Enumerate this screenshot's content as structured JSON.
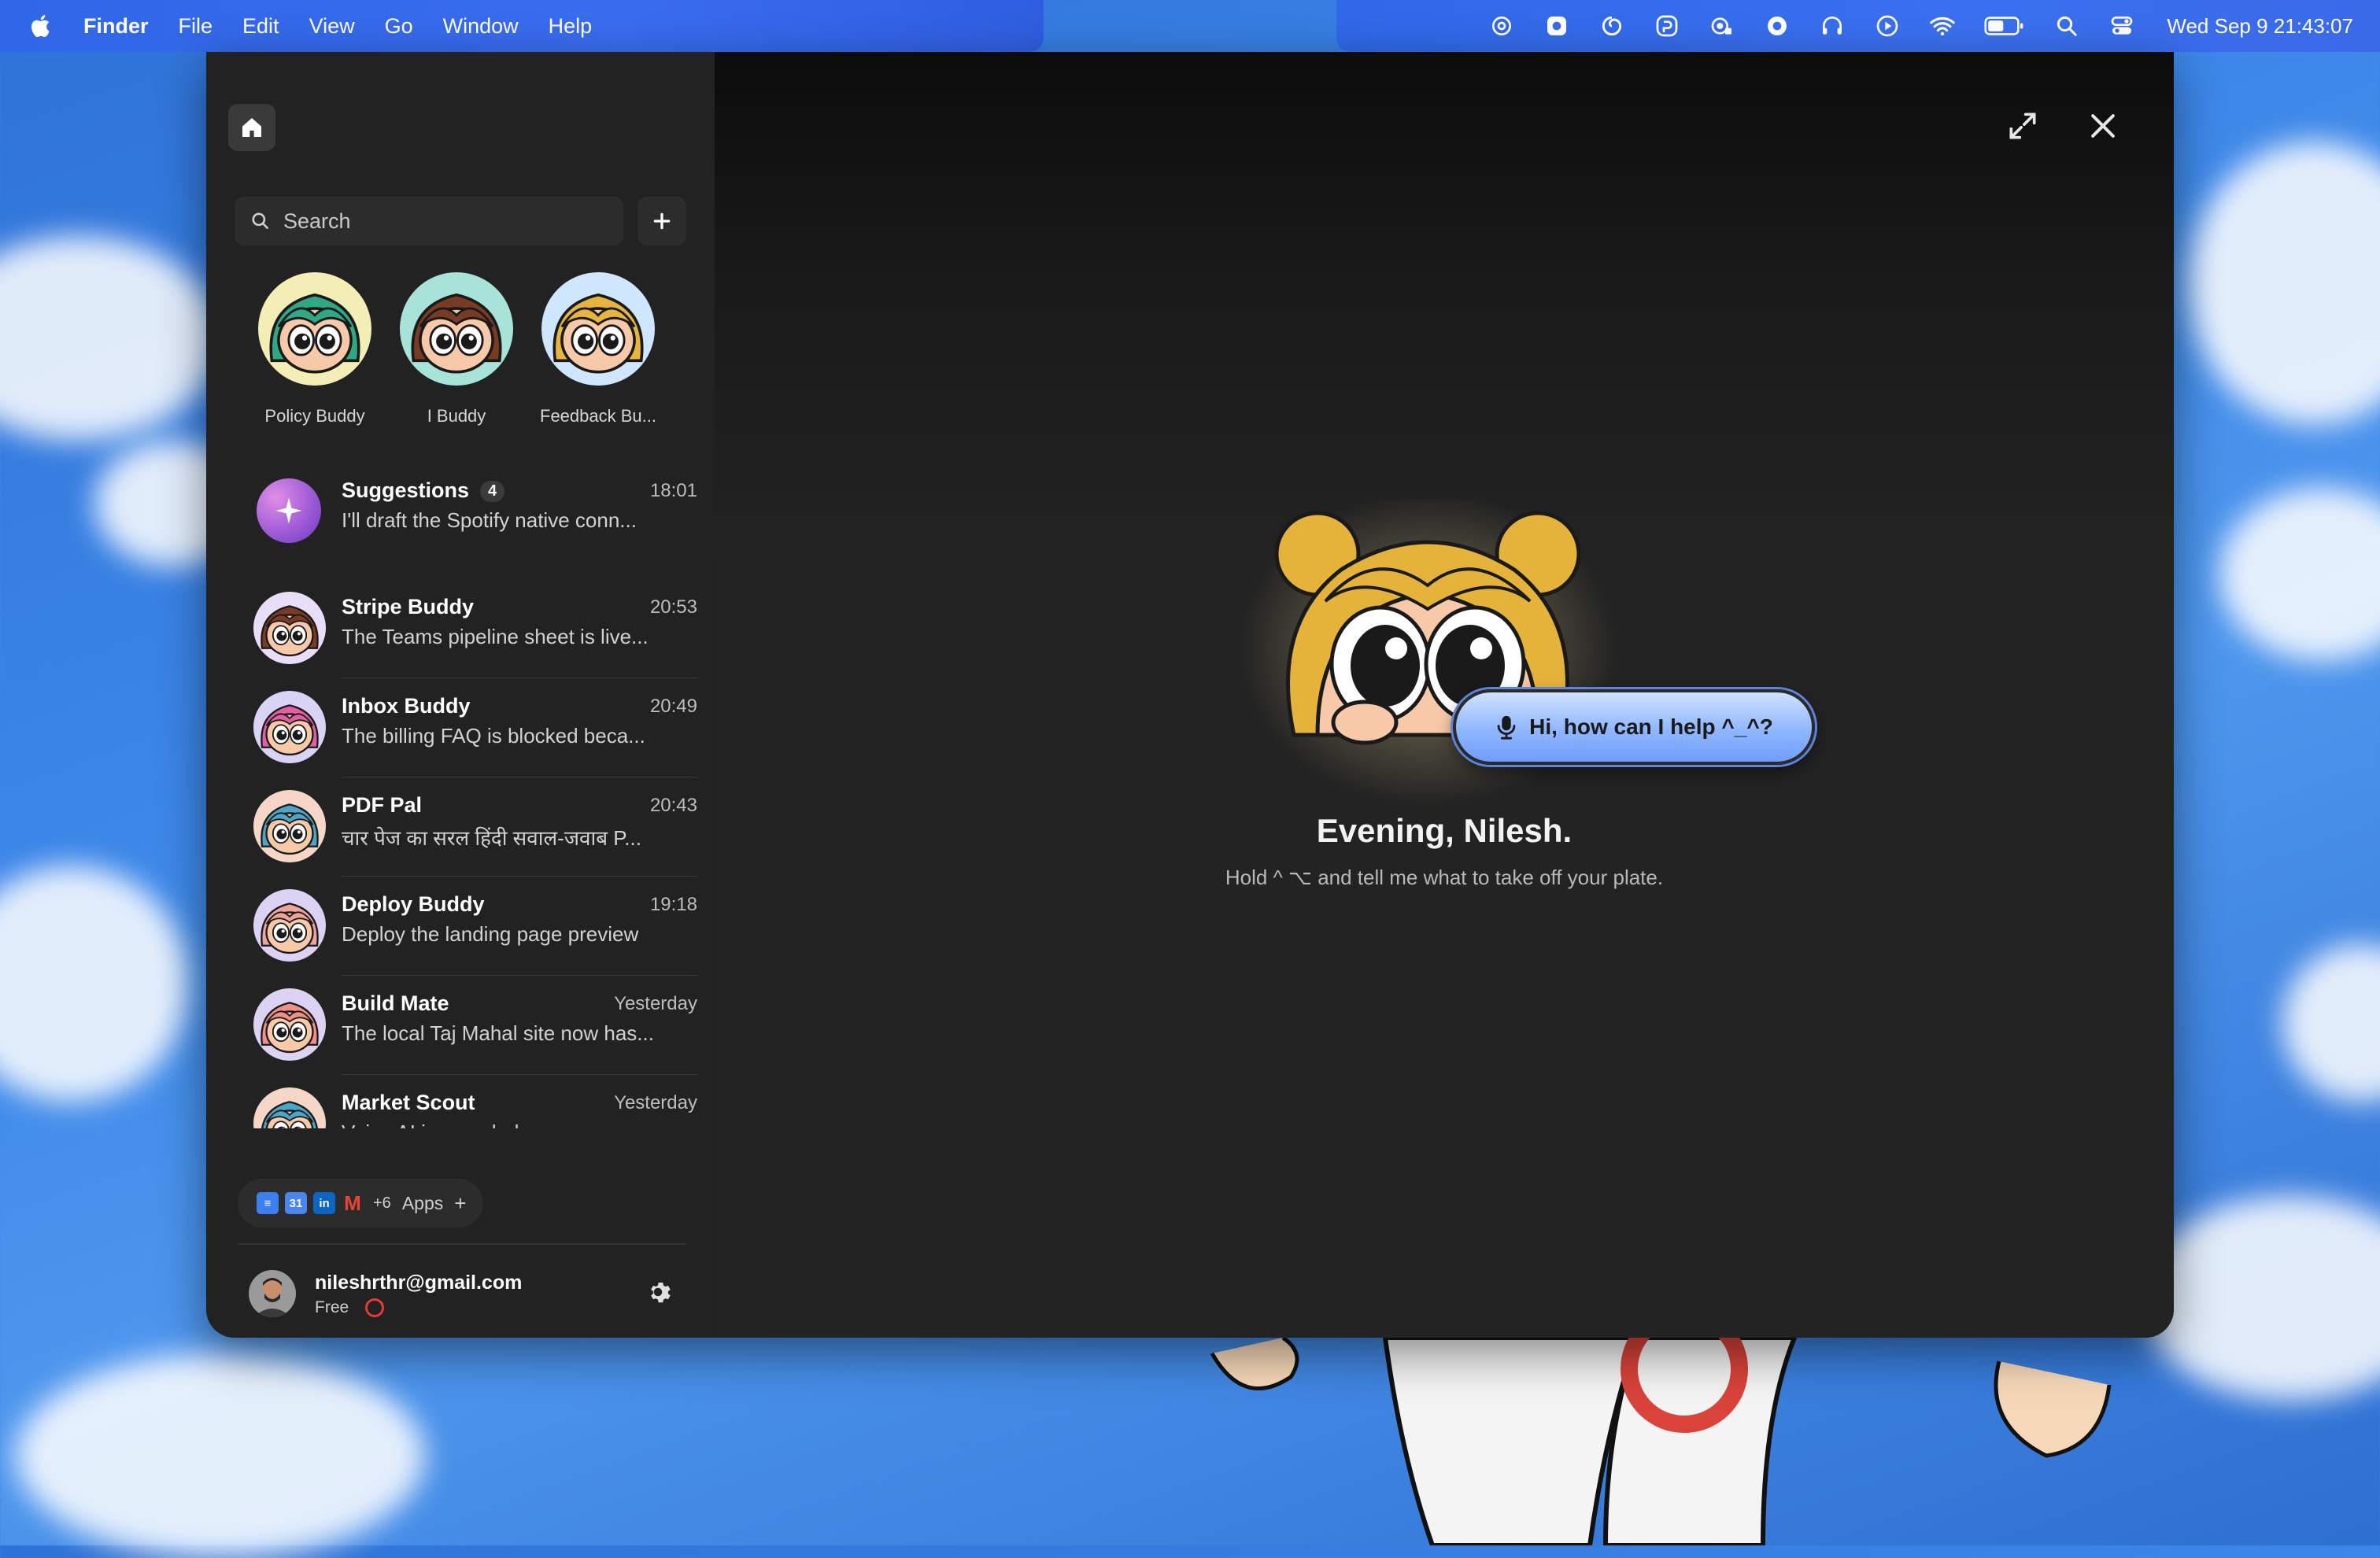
{
  "menubar": {
    "app": "Finder",
    "items": [
      "File",
      "Edit",
      "View",
      "Go",
      "Window",
      "Help"
    ],
    "clock": "Wed Sep 9  21:43:07"
  },
  "sidebar": {
    "search_placeholder": "Search",
    "pinned": [
      {
        "label": "Policy Buddy",
        "bg": "#f2eeb5",
        "hair": "#2fa884"
      },
      {
        "label": "I Buddy",
        "bg": "#a7e3d8",
        "hair": "#7a3b24"
      },
      {
        "label": "Feedback Bu...",
        "bg": "#cfe6ff",
        "hair": "#e8b53c"
      }
    ],
    "conversations": [
      {
        "name": "Suggestions",
        "badge": "4",
        "time": "18:01",
        "preview": "I'll draft the Spotify native conn...",
        "type": "suggestions"
      },
      {
        "name": "Stripe Buddy",
        "time": "20:53",
        "preview": "The Teams pipeline sheet is live...",
        "bg": "#e9def8",
        "hair": "#7a3b24"
      },
      {
        "name": "Inbox Buddy",
        "time": "20:49",
        "preview": "The billing FAQ is blocked beca...",
        "bg": "#d9d4f5",
        "hair": "#e35ea0"
      },
      {
        "name": "PDF Pal",
        "time": "20:43",
        "preview": "चार पेज का सरल हिंदी सवाल-जवाब P...",
        "bg": "#f6d6c6",
        "hair": "#4aa5c9"
      },
      {
        "name": "Deploy Buddy",
        "time": "19:18",
        "preview": "Deploy the landing page preview",
        "bg": "#dcd2f3",
        "hair": "#f0a39b"
      },
      {
        "name": "Build Mate",
        "time": "Yesterday",
        "preview": "The local Taj Mahal site now has...",
        "bg": "#dcd2f3",
        "hair": "#ef8f86"
      },
      {
        "name": "Market Scout",
        "time": "Yesterday",
        "preview": "Voice AI is crowded on conversa...",
        "bg": "#f6d6c6",
        "hair": "#4aa5c9"
      }
    ],
    "apps": {
      "more": "+6",
      "label": "Apps",
      "plus": "+"
    },
    "profile": {
      "email": "nileshrthr@gmail.com",
      "plan": "Free"
    }
  },
  "main": {
    "help_button": "Hi, how can I help ^_^?",
    "greeting": "Evening, Nilesh.",
    "hint": "Hold ^ ⌥ and tell me what to take off your plate."
  },
  "colors": {
    "accent": "#6f9dfb",
    "window_bg": "#222222",
    "badge_red": "#e53935"
  }
}
